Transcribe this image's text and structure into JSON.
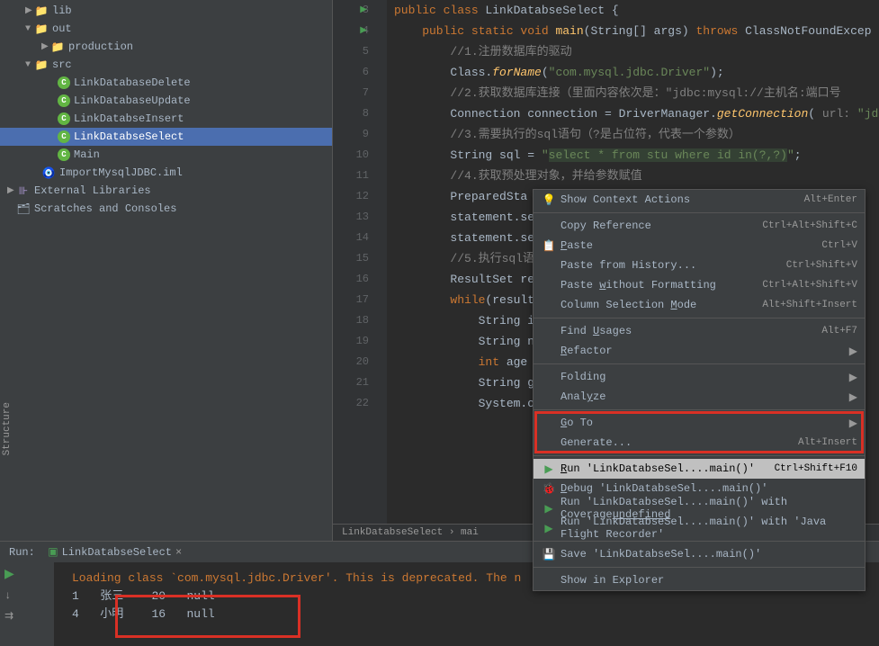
{
  "tree": {
    "lib": "lib",
    "out": "out",
    "production": "production",
    "src": "src",
    "files": [
      "LinkDatabaseDelete",
      "LinkDatabaseUpdate",
      "LinkDatabseInsert",
      "LinkDatabseSelect",
      "Main"
    ],
    "iml": "ImportMysqlJDBC.iml",
    "external": "External Libraries",
    "scratches": "Scratches and Consoles"
  },
  "gutter": [
    "3",
    "4",
    "5",
    "6",
    "7",
    "8",
    "9",
    "10",
    "11",
    "12",
    "13",
    "14",
    "15",
    "16",
    "17",
    "18",
    "19",
    "20",
    "21",
    "22"
  ],
  "code": {
    "l3": {
      "pre": "public class ",
      "cls": "LinkDatabseSelect ",
      "brace": "{"
    },
    "l4": {
      "pre": "    public static void ",
      "mtd": "main",
      "sig": "(String[] args) ",
      "thr": "throws ",
      "ex": "ClassNotFoundExcep"
    },
    "l5": "        //1.注册数据库的驱动",
    "l6": {
      "a": "        Class.",
      "b": "forName",
      "c": "(",
      "d": "\"com.mysql.jdbc.Driver\"",
      "e": ");"
    },
    "l7": "        //2.获取数据库连接（里面内容依次是：\"jdbc:mysql://主机名:端口号",
    "l8": {
      "a": "        Connection connection = DriverManager.",
      "b": "getConnection",
      "c": "( ",
      "p": "url: ",
      "d": "\"jd"
    },
    "l9": "        //3.需要执行的sql语句（?是占位符，代表一个参数）",
    "l10": {
      "a": "        String sql = ",
      "b": "\"",
      "c": "select ",
      "d": "* ",
      "e": "from ",
      "f": "stu ",
      "g": "where ",
      "h": "id ",
      "i": "in",
      "j": "(?,?)",
      "k": "\"",
      "l": ";"
    },
    "l11": "        //4.获取预处理对象，并给参数赋值",
    "l12": {
      "a": "        PreparedSta"
    },
    "l13": "        statement.se",
    "l14": "        statement.se",
    "l15": "        //5.执行sql语",
    "l16": "        ResultSet re",
    "l17": {
      "a": "        while",
      "b": "(result"
    },
    "l18": "            String i",
    "l19": "            String n",
    "l20": {
      "a": "            int ",
      "b": "age "
    },
    "l21": "            String g",
    "l22": "            System.o"
  },
  "breadcrumb": {
    "a": "LinkDatabseSelect",
    "b": "mai"
  },
  "console": {
    "run_label": "Run:",
    "tab": "LinkDatabseSelect",
    "loading": "Loading class `com.mysql.jdbc.Driver'. This is deprecated. The n",
    "rows": [
      {
        "id": "1",
        "name": "张三",
        "age": "20",
        "extra": "null"
      },
      {
        "id": "4",
        "name": "小明",
        "age": "16",
        "extra": "null"
      }
    ]
  },
  "menu": {
    "items": [
      {
        "icon": "💡",
        "label": "Show Context Actions",
        "shortcut": "Alt+Enter"
      },
      "sep",
      {
        "label": "Copy Reference",
        "shortcut": "Ctrl+Alt+Shift+C"
      },
      {
        "icon": "📋",
        "label": "Paste",
        "shortcut": "Ctrl+V",
        "u": 0
      },
      {
        "label": "Paste from History...",
        "shortcut": "Ctrl+Shift+V"
      },
      {
        "label": "Paste without Formatting",
        "shortcut": "Ctrl+Alt+Shift+V",
        "u": 6
      },
      {
        "label": "Column Selection Mode",
        "shortcut": "Alt+Shift+Insert",
        "u": 17
      },
      "sep",
      {
        "label": "Find Usages",
        "shortcut": "Alt+F7",
        "u": 5
      },
      {
        "label": "Refactor",
        "arrow": true,
        "u": 0
      },
      "sep",
      {
        "label": "Folding",
        "arrow": true
      },
      {
        "label": "Analyze",
        "arrow": true,
        "u": 4
      },
      "sep",
      {
        "label": "Go To",
        "arrow": true,
        "u": 0
      },
      {
        "label": "Generate...",
        "shortcut": "Alt+Insert"
      },
      "sep",
      {
        "icon": "▶",
        "label": "Run 'LinkDatabseSel....main()'",
        "shortcut": "Ctrl+Shift+F10",
        "hl": true,
        "u": 0,
        "green": true
      },
      {
        "icon": "🐞",
        "label": "Debug 'LinkDatabseSel....main()'",
        "u": 0
      },
      {
        "icon": "▶",
        "label": "Run 'LinkDatabseSel....main()' with Coverage",
        "green": true,
        "u": 44
      },
      {
        "icon": "▶",
        "label": "Run 'LinkDatabseSel....main()' with 'Java Flight Recorder'",
        "green": true
      },
      "sep",
      {
        "icon": "💾",
        "label": "Save 'LinkDatabseSel....main()'"
      },
      "sep",
      {
        "label": "Show in Explorer"
      }
    ]
  },
  "vtab": "Structure"
}
